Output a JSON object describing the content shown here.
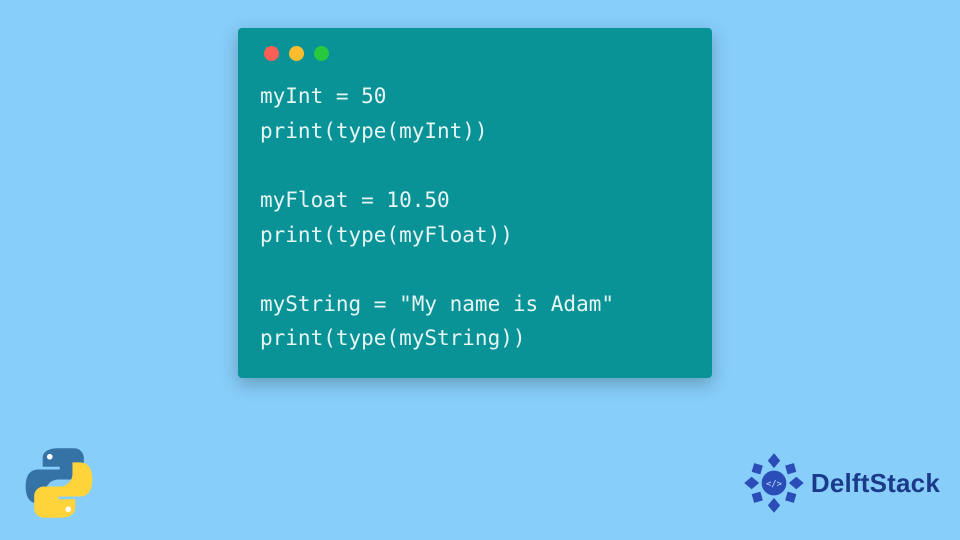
{
  "code": {
    "lines": [
      "myInt = 50",
      "print(type(myInt))",
      "",
      "myFloat = 10.50",
      "print(type(myFloat))",
      "",
      "myString = \"My name is Adam\"",
      "print(type(myString))"
    ]
  },
  "brand": {
    "name": "DelftStack"
  },
  "icons": {
    "python": "python-logo",
    "delft_badge": "delft-badge"
  }
}
